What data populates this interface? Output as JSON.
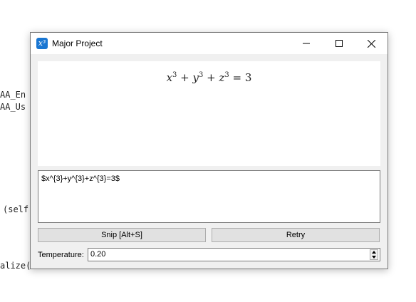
{
  "background_code": {
    "line1": "AA_En",
    "line2": "AA_Us",
    "line3": "(self",
    "line4": "alize(…………"
  },
  "window": {
    "title": "Major Project",
    "icon_text": "x³",
    "controls": [
      "minimize",
      "maximize",
      "close"
    ]
  },
  "preview": {
    "rendered_formula": "x^3 + y^3 + z^3 = 3"
  },
  "editor": {
    "latex": "$x^{3}+y^{3}+z^{3}=3$"
  },
  "buttons": {
    "snip_label": "Snip [Alt+S]",
    "retry_label": "Retry"
  },
  "temperature": {
    "label": "Temperature:",
    "value": "0.20"
  },
  "colors": {
    "accent": "#1976d2",
    "window_bg": "#f0f0f0",
    "button_bg": "#e1e1e1"
  }
}
